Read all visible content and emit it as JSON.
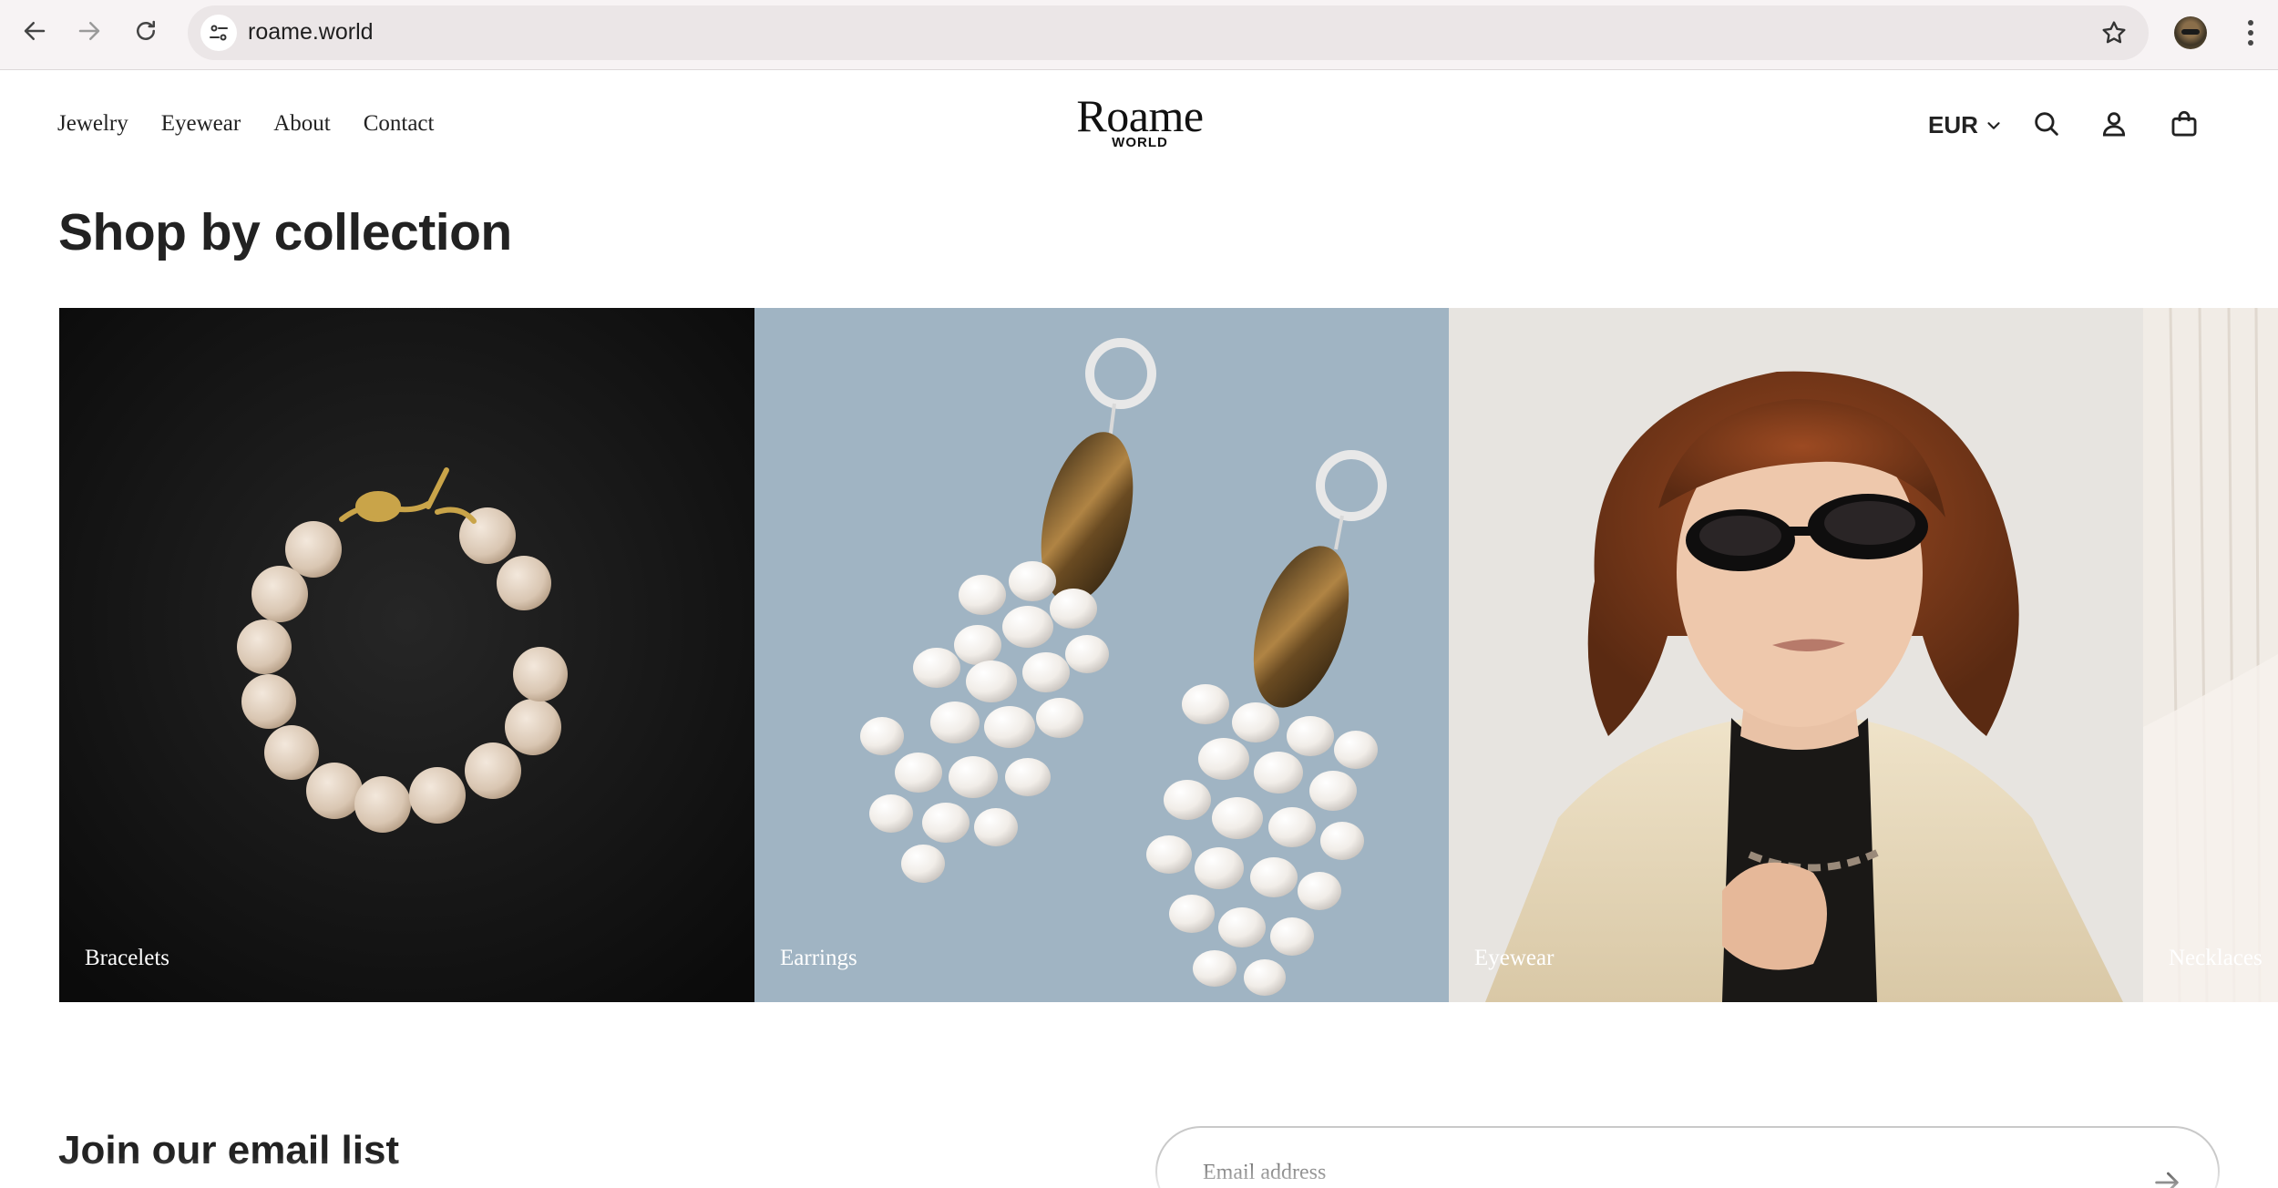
{
  "browser": {
    "url": "roame.world",
    "icons": {
      "back": "arrow-left-icon",
      "forward": "arrow-right-icon",
      "reload": "reload-icon",
      "site_info": "tune-icon",
      "bookmark": "star-icon",
      "profile": "avatar",
      "menu": "vertical-dots-icon"
    }
  },
  "header": {
    "nav": [
      {
        "label": "Jewelry"
      },
      {
        "label": "Eyewear"
      },
      {
        "label": "About"
      },
      {
        "label": "Contact"
      }
    ],
    "logo": {
      "main": "Roame",
      "sub": "WORLD"
    },
    "currency": "EUR",
    "icons": [
      "search-icon",
      "account-icon",
      "cart-icon"
    ]
  },
  "collections": {
    "title": "Shop by collection",
    "tiles": [
      {
        "label": "Bracelets",
        "color": "#141414"
      },
      {
        "label": "Earrings",
        "color": "#9fb3c1"
      },
      {
        "label": "Eyewear",
        "color": "#e7e4e0"
      },
      {
        "label": "Necklaces",
        "color": "#f1ece6"
      }
    ]
  },
  "newsletter": {
    "title": "Join our email list",
    "placeholder": "Email address"
  }
}
